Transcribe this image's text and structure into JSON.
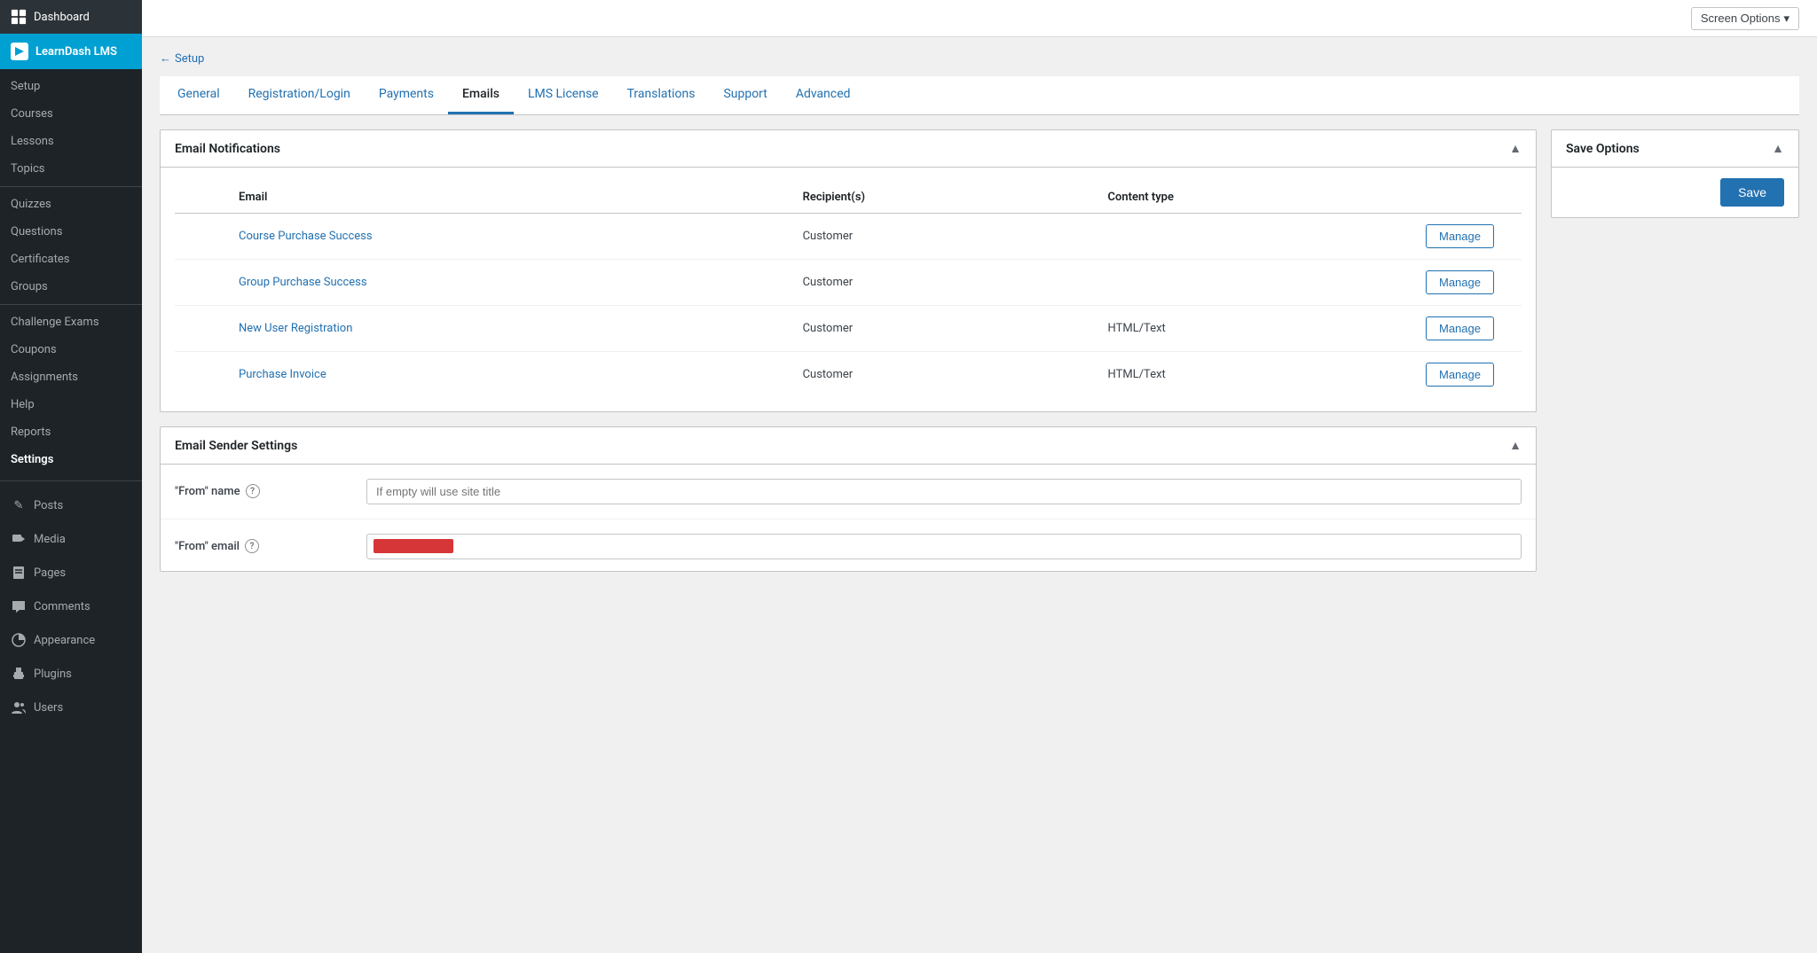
{
  "topbar": {
    "screen_options_label": "Screen Options",
    "chevron_symbol": "▾"
  },
  "breadcrumb": {
    "arrow": "←",
    "label": "Setup"
  },
  "tabs": [
    {
      "id": "general",
      "label": "General",
      "active": false
    },
    {
      "id": "registration-login",
      "label": "Registration/Login",
      "active": false
    },
    {
      "id": "payments",
      "label": "Payments",
      "active": false
    },
    {
      "id": "emails",
      "label": "Emails",
      "active": true
    },
    {
      "id": "lms-license",
      "label": "LMS License",
      "active": false
    },
    {
      "id": "translations",
      "label": "Translations",
      "active": false
    },
    {
      "id": "support",
      "label": "Support",
      "active": false
    },
    {
      "id": "advanced",
      "label": "Advanced",
      "active": false
    }
  ],
  "email_notifications": {
    "panel_title": "Email Notifications",
    "table_headers": {
      "email": "Email",
      "recipients": "Recipient(s)",
      "content_type": "Content type"
    },
    "rows": [
      {
        "id": "course-purchase-success",
        "email": "Course Purchase Success",
        "recipients": "Customer",
        "content_type": "",
        "manage_label": "Manage",
        "enabled": true
      },
      {
        "id": "group-purchase-success",
        "email": "Group Purchase Success",
        "recipients": "Customer",
        "content_type": "",
        "manage_label": "Manage",
        "enabled": true
      },
      {
        "id": "new-user-registration",
        "email": "New User Registration",
        "recipients": "Customer",
        "content_type": "HTML/Text",
        "manage_label": "Manage",
        "enabled": true
      },
      {
        "id": "purchase-invoice",
        "email": "Purchase Invoice",
        "recipients": "Customer",
        "content_type": "HTML/Text",
        "manage_label": "Manage",
        "enabled": true
      }
    ]
  },
  "email_sender": {
    "panel_title": "Email Sender Settings",
    "from_name_label": "\"From\" name",
    "from_name_placeholder": "If empty will use site title",
    "from_email_label": "\"From\" email",
    "from_email_value": ""
  },
  "save_options": {
    "panel_title": "Save Options",
    "save_label": "Save"
  },
  "sidebar": {
    "top_items": [
      {
        "id": "dashboard",
        "label": "Dashboard",
        "icon": "⊞"
      },
      {
        "id": "learndash-lms",
        "label": "LearnDash LMS",
        "icon": "●"
      }
    ],
    "learndash_items": [
      {
        "id": "setup",
        "label": "Setup"
      },
      {
        "id": "courses",
        "label": "Courses"
      },
      {
        "id": "lessons",
        "label": "Lessons"
      },
      {
        "id": "topics",
        "label": "Topics"
      },
      {
        "id": "quizzes",
        "label": "Quizzes"
      },
      {
        "id": "questions",
        "label": "Questions"
      },
      {
        "id": "certificates",
        "label": "Certificates"
      },
      {
        "id": "groups",
        "label": "Groups"
      },
      {
        "id": "challenge-exams",
        "label": "Challenge Exams"
      },
      {
        "id": "coupons",
        "label": "Coupons"
      },
      {
        "id": "assignments",
        "label": "Assignments"
      },
      {
        "id": "help",
        "label": "Help"
      },
      {
        "id": "reports",
        "label": "Reports"
      },
      {
        "id": "settings",
        "label": "Settings",
        "active": true
      }
    ],
    "wp_items": [
      {
        "id": "posts",
        "label": "Posts",
        "icon": "✎"
      },
      {
        "id": "media",
        "label": "Media",
        "icon": "◫"
      },
      {
        "id": "pages",
        "label": "Pages",
        "icon": "⬜"
      },
      {
        "id": "comments",
        "label": "Comments",
        "icon": "💬"
      },
      {
        "id": "appearance",
        "label": "Appearance",
        "icon": "◑"
      },
      {
        "id": "plugins",
        "label": "Plugins",
        "icon": "⊞"
      },
      {
        "id": "users",
        "label": "Users",
        "icon": "👤"
      }
    ]
  }
}
